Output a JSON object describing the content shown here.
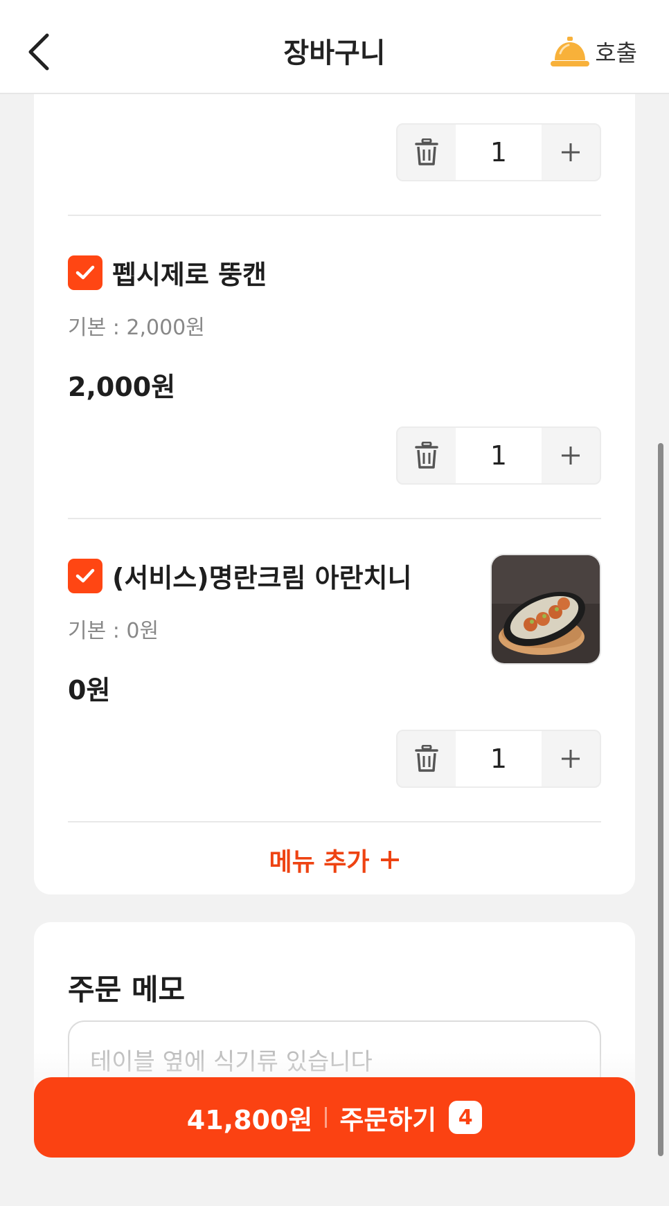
{
  "header": {
    "title": "장바구니",
    "call_label": "호출",
    "back_icon": "chevron-left-icon",
    "call_icon": "service-bell-icon",
    "bell_color": "#f8b13a"
  },
  "items": [
    {
      "quantity": "1"
    },
    {
      "name": "펩시제로 뚱캔",
      "base": "기본 : 2,000원",
      "price": "2,000원",
      "quantity": "1",
      "checked": true
    },
    {
      "name": "(서비스)명란크림 아란치니",
      "base": "기본 : 0원",
      "price": "0원",
      "quantity": "1",
      "checked": true
    }
  ],
  "add_menu": {
    "label": "메뉴 추가"
  },
  "memo": {
    "title": "주문 메모",
    "placeholder": "테이블 옆에 식기류 있습니다"
  },
  "order": {
    "total": "41,800원",
    "label": "주문하기",
    "count": "4"
  },
  "colors": {
    "accent": "#fb4212",
    "checkbox": "#ff4613",
    "background": "#f2f2f2"
  }
}
